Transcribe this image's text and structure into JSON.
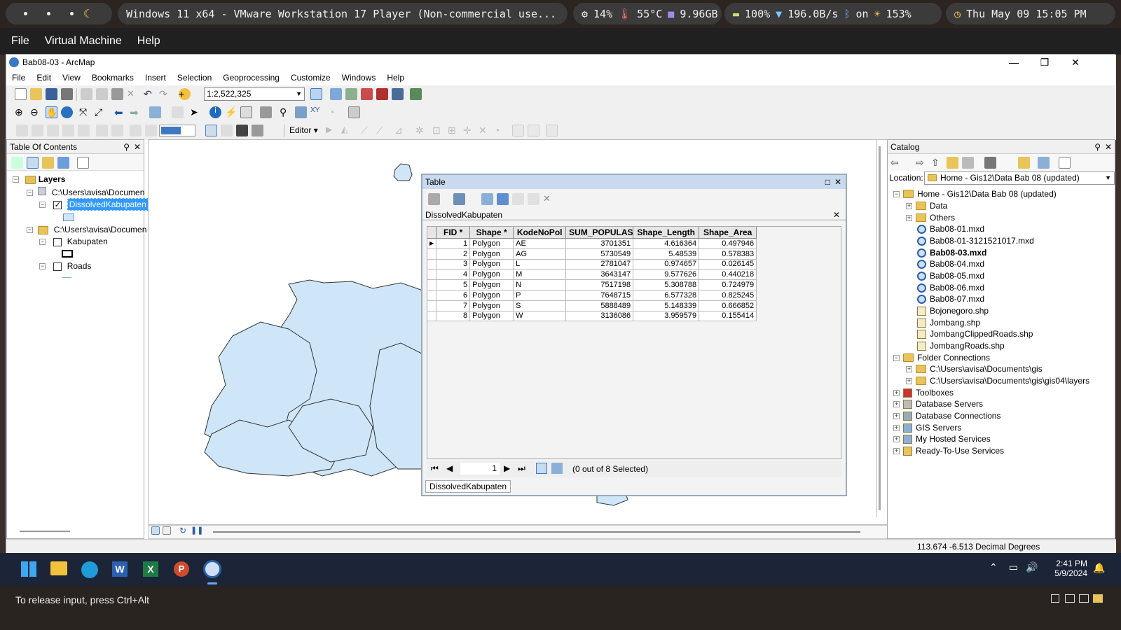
{
  "host": {
    "vm_title": "Windows 11 x64 - VMware Workstation 17 Player (Non-commercial use...",
    "stats": {
      "cpu": "14%",
      "temp": "55°C",
      "mem": "9.96GB",
      "battery": "100%",
      "net": "196.0B/s",
      "bt": "on",
      "brightness": "153%"
    },
    "clock": "Thu May 09 15:05 PM",
    "menu": [
      "File",
      "Virtual Machine",
      "Help"
    ],
    "status": "To release input, press Ctrl+Alt"
  },
  "arcmap": {
    "title": "Bab08-03 - ArcMap",
    "menu": [
      "File",
      "Edit",
      "View",
      "Bookmarks",
      "Insert",
      "Selection",
      "Geoprocessing",
      "Customize",
      "Windows",
      "Help"
    ],
    "scale": "1:2,522,325",
    "editor_label": "Editor",
    "statusbar": "113.674  -6.513 Decimal Degrees"
  },
  "toc": {
    "title": "Table Of Contents",
    "layers_label": "Layers",
    "path1": "C:\\Users\\avisa\\Documen",
    "layer_dissolved": "DissolvedKabupaten",
    "path2": "C:\\Users\\avisa\\Documen",
    "layer_kab": "Kabupaten",
    "layer_roads": "Roads"
  },
  "table": {
    "title": "Table",
    "tab_title": "DissolvedKabupaten",
    "columns": [
      "FID *",
      "Shape *",
      "KodeNoPol",
      "SUM_POPULASI",
      "Shape_Length",
      "Shape_Area"
    ],
    "rows": [
      [
        "1",
        "Polygon",
        "AE",
        "3701351",
        "4.616364",
        "0.497946"
      ],
      [
        "2",
        "Polygon",
        "AG",
        "5730549",
        "5.48539",
        "0.578383"
      ],
      [
        "3",
        "Polygon",
        "L",
        "2781047",
        "0.974657",
        "0.026145"
      ],
      [
        "4",
        "Polygon",
        "M",
        "3643147",
        "9.577626",
        "0.440218"
      ],
      [
        "5",
        "Polygon",
        "N",
        "7517198",
        "5.308788",
        "0.724979"
      ],
      [
        "6",
        "Polygon",
        "P",
        "7648715",
        "6.577328",
        "0.825245"
      ],
      [
        "7",
        "Polygon",
        "S",
        "5888489",
        "5.148339",
        "0.666852"
      ],
      [
        "8",
        "Polygon",
        "W",
        "3136086",
        "3.959579",
        "0.155414"
      ]
    ],
    "record": "1",
    "selected_text": "(0 out of 8 Selected)",
    "bottom_tab": "DissolvedKabupaten"
  },
  "catalog": {
    "title": "Catalog",
    "location_label": "Location:",
    "location_value": "Home - Gis12\\Data Bab 08 (updated)",
    "home": "Home - Gis12\\Data Bab 08 (updated)",
    "items": [
      "Data",
      "Others",
      "Bab08-01.mxd",
      "Bab08-01-3121521017.mxd",
      "Bab08-03.mxd",
      "Bab08-04.mxd",
      "Bab08-05.mxd",
      "Bab08-06.mxd",
      "Bab08-07.mxd",
      "Bojonegoro.shp",
      "Jombang.shp",
      "JombangClippedRoads.shp",
      "JombangRoads.shp"
    ],
    "folder_connections": "Folder Connections",
    "fc1": "C:\\Users\\avisa\\Documents\\gis",
    "fc2": "C:\\Users\\avisa\\Documents\\gis\\gis04\\layers",
    "roots": [
      "Toolboxes",
      "Database Servers",
      "Database Connections",
      "GIS Servers",
      "My Hosted Services",
      "Ready-To-Use Services"
    ]
  },
  "taskbar": {
    "time": "2:41 PM",
    "date": "5/9/2024"
  },
  "colors": {
    "map_fill": "#cfe6f8",
    "selection": "#3399ff",
    "taskbar": "#1c2537"
  }
}
